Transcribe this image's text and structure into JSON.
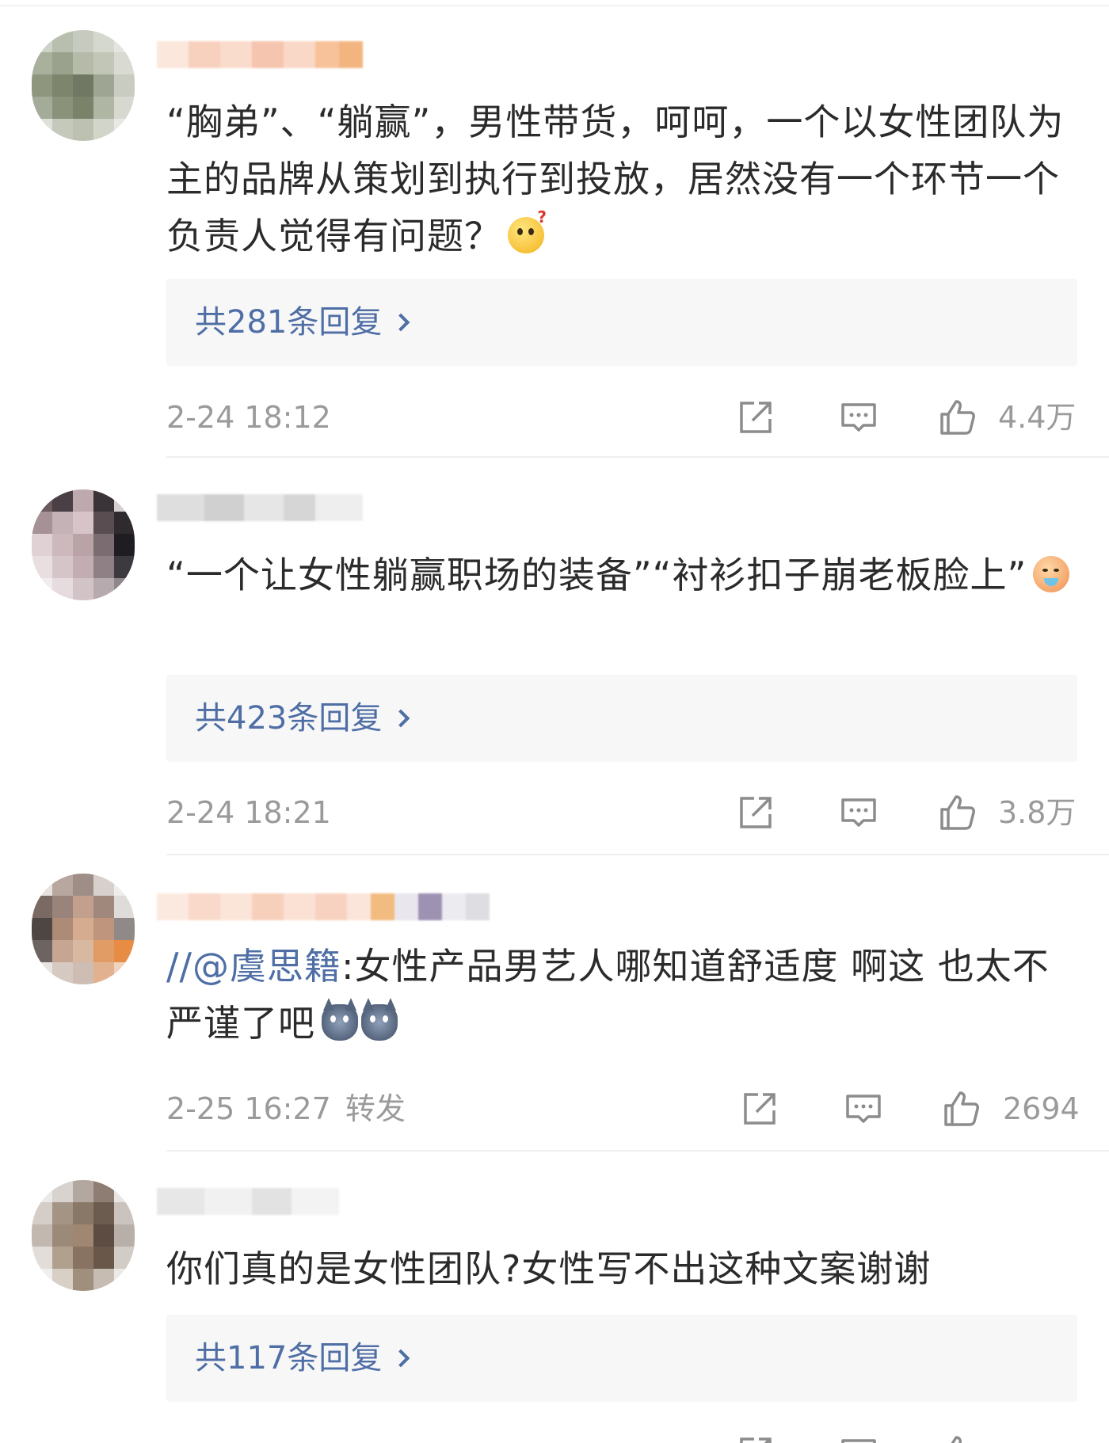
{
  "comments": [
    {
      "text": "“胸弟”、“躺赢”，男性带货，呵呵，一个以女性团队为主的品牌从策划到执行到投放，居然没有一个环节一个负责人觉得有问题？",
      "emoji": "thinking-face",
      "replies": "共281条回复",
      "time": "2-24 18:12",
      "likes": "4.4万"
    },
    {
      "text": "“一个让女性躺赢职场的装备”“衬衫扣子崩老板脸上”",
      "emoji": "vomiting-face",
      "replies": "共423条回复",
      "time": "2-24 18:21",
      "likes": "3.8万"
    },
    {
      "prefix": "//",
      "mention": "@虞思籍",
      "text": ":女性产品男艺人哪知道舒适度 啊这 也太不严谨了吧",
      "emoji": "tom-cat-face",
      "time": "2-25 16:27",
      "extra": "转发",
      "likes": "2694"
    },
    {
      "text": "你们真的是女性团队?女性写不出这种文案谢谢",
      "replies": "共117条回复"
    }
  ],
  "icons": {
    "share": "share-icon",
    "comment": "comment-icon",
    "like": "thumbs-up-icon"
  },
  "colors": {
    "link": "#4e6ea5",
    "meta": "#9a9a9a",
    "reply_bg": "#f7f7f7"
  }
}
